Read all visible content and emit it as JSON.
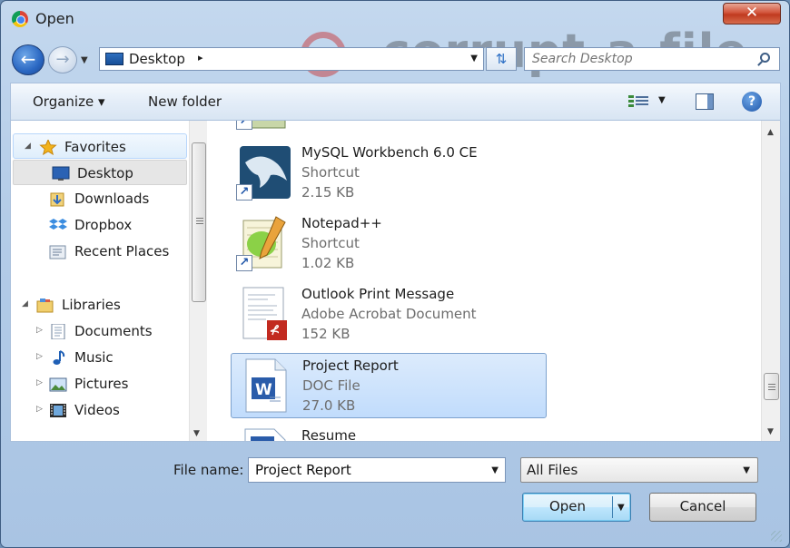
{
  "window": {
    "title": "Open",
    "close_glyph": "✕",
    "watermark_text": "corrupt-a-file"
  },
  "address": {
    "location": "Desktop",
    "separator": "▸",
    "search_placeholder": "Search Desktop"
  },
  "toolbar": {
    "organize_label": "Organize ▾",
    "new_folder_label": "New folder"
  },
  "sidebar": {
    "favorites_label": "Favorites",
    "favorites": [
      {
        "label": "Desktop",
        "icon": "desktop-icon"
      },
      {
        "label": "Downloads",
        "icon": "downloads-icon"
      },
      {
        "label": "Dropbox",
        "icon": "dropbox-icon"
      },
      {
        "label": "Recent Places",
        "icon": "recent-places-icon"
      }
    ],
    "libraries_label": "Libraries",
    "libraries": [
      {
        "label": "Documents",
        "icon": "documents-icon"
      },
      {
        "label": "Music",
        "icon": "music-icon"
      },
      {
        "label": "Pictures",
        "icon": "pictures-icon"
      },
      {
        "label": "Videos",
        "icon": "videos-icon"
      }
    ]
  },
  "files": [
    {
      "name": "",
      "type": "Shortcut",
      "size": ""
    },
    {
      "name": "MySQL Workbench 6.0 CE",
      "type": "Shortcut",
      "size": "2.15 KB"
    },
    {
      "name": "Notepad++",
      "type": "Shortcut",
      "size": "1.02 KB"
    },
    {
      "name": "Outlook Print Message",
      "type": "Adobe Acrobat Document",
      "size": "152 KB"
    },
    {
      "name": "Project Report",
      "type": "DOC File",
      "size": "27.0 KB",
      "selected": true
    },
    {
      "name": "Resume",
      "type": "",
      "size": ""
    }
  ],
  "bottom": {
    "file_name_label": "File name:",
    "file_name_value": "Project Report",
    "filter_value": "All Files",
    "open_label": "Open",
    "cancel_label": "Cancel"
  },
  "colors": {
    "accent": "#2a67c2",
    "selection": "#c1dcfc",
    "close": "#c03a1f"
  }
}
